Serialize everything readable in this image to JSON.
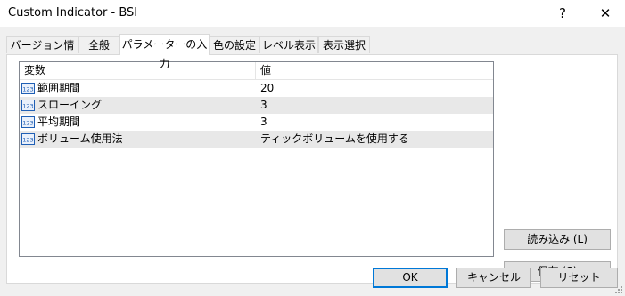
{
  "window": {
    "title": "Custom Indicator - BSI",
    "help_glyph": "?",
    "close_glyph": "✕"
  },
  "tabs": [
    {
      "label": "バージョン情報"
    },
    {
      "label": "全般"
    },
    {
      "label": "パラメーターの入力",
      "active": true
    },
    {
      "label": "色の設定"
    },
    {
      "label": "レベル表示"
    },
    {
      "label": "表示選択"
    }
  ],
  "grid": {
    "headers": {
      "variable": "変数",
      "value": "値"
    },
    "rows": [
      {
        "name": "範囲期間",
        "value": "20",
        "icon": "integer-param-icon"
      },
      {
        "name": "スローイング",
        "value": "3",
        "icon": "integer-param-icon"
      },
      {
        "name": "平均期間",
        "value": "3",
        "icon": "integer-param-icon"
      },
      {
        "name": "ボリューム使用法",
        "value": "ティックボリュームを使用する",
        "icon": "integer-param-icon"
      }
    ],
    "icon_text": "123"
  },
  "side_buttons": {
    "load": "読み込み (L)",
    "save": "保存 (S)"
  },
  "footer_buttons": {
    "ok": "OK",
    "cancel": "キャンセル",
    "reset": "リセット"
  },
  "colors": {
    "accent": "#0078d7",
    "alt_row": "#e8e8e8",
    "icon_blue": "#1f5fb5"
  }
}
